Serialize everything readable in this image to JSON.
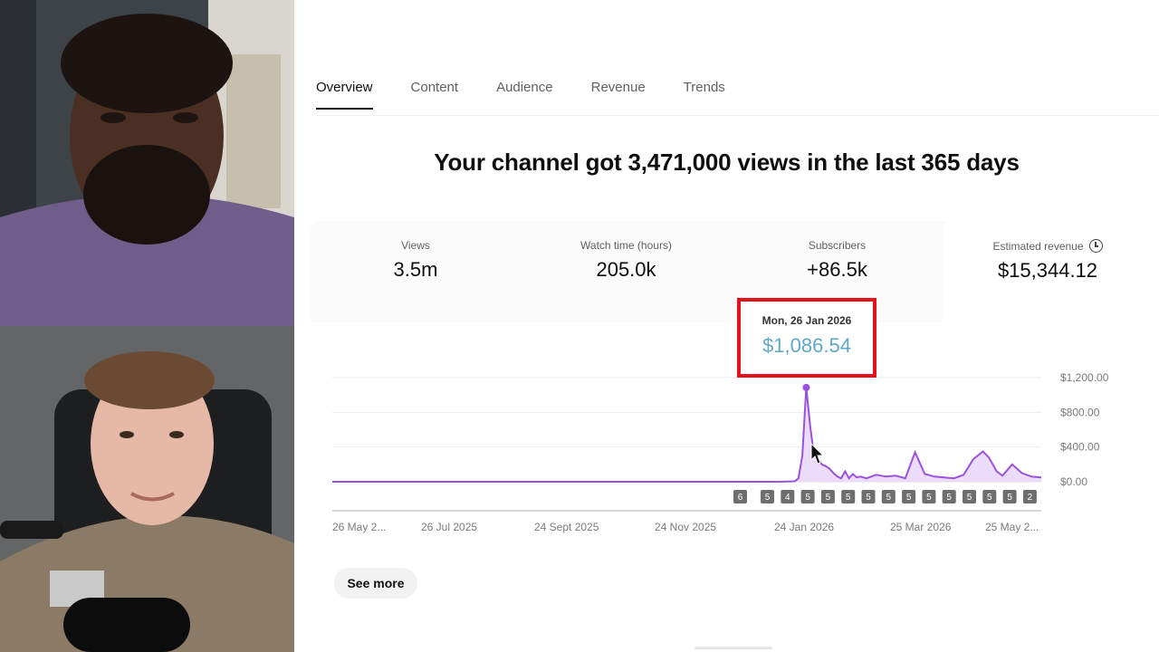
{
  "tabs": [
    {
      "label": "Overview",
      "active": true
    },
    {
      "label": "Content",
      "active": false
    },
    {
      "label": "Audience",
      "active": false
    },
    {
      "label": "Revenue",
      "active": false
    },
    {
      "label": "Trends",
      "active": false
    }
  ],
  "headline": "Your channel got 3,471,000 views in the last 365 days",
  "metrics": [
    {
      "label": "Views",
      "value": "3.5m"
    },
    {
      "label": "Watch time (hours)",
      "value": "205.0k"
    },
    {
      "label": "Subscribers",
      "value": "+86.5k"
    },
    {
      "label": "Estimated revenue",
      "value": "$15,344.12",
      "icon": "clock-icon"
    }
  ],
  "tooltip": {
    "date": "Mon, 26 Jan 2026",
    "value": "$1,086.54"
  },
  "see_more_label": "See more",
  "colors": {
    "accent": "#a855f7",
    "line": "#9b51e0",
    "fill": "#ead8fb",
    "tooltip_value": "#5fa8c9",
    "highlight_box": "#e5121b"
  },
  "chart_data": {
    "type": "area",
    "metric": "Estimated revenue",
    "yticks": [
      "$1,200.00",
      "$800.00",
      "$400.00",
      "$0.00"
    ],
    "ylim": [
      0,
      1200
    ],
    "xticks": [
      "26 May 2...",
      "26 Jul 2025",
      "24 Sept 2025",
      "24 Nov 2025",
      "24 Jan 2026",
      "25 Mar 2026",
      "25 May 2..."
    ],
    "series": [
      {
        "x_day": [
          0,
          60,
          120,
          180,
          230,
          238,
          240,
          242,
          244,
          246,
          248,
          250,
          252,
          254,
          256,
          258,
          260,
          262,
          264,
          266,
          268,
          270,
          272,
          275,
          280,
          285,
          290,
          295,
          300,
          305,
          310,
          315,
          320,
          325,
          330,
          335,
          338,
          340,
          342,
          345,
          350,
          355,
          360,
          365
        ],
        "values": [
          0,
          0,
          0,
          0,
          0,
          5,
          40,
          300,
          1086.54,
          650,
          300,
          260,
          200,
          180,
          150,
          100,
          60,
          40,
          120,
          40,
          90,
          50,
          60,
          40,
          80,
          60,
          70,
          40,
          340,
          90,
          60,
          50,
          40,
          80,
          260,
          350,
          280,
          200,
          120,
          70,
          200,
          100,
          60,
          50
        ]
      }
    ],
    "video_markers": [
      "6",
      "5",
      "4",
      "5",
      "5",
      "5",
      "5",
      "5",
      "5",
      "5",
      "5",
      "5",
      "5",
      "5",
      "2"
    ],
    "highlight": {
      "date": "Mon, 26 Jan 2026",
      "value": 1086.54
    }
  }
}
